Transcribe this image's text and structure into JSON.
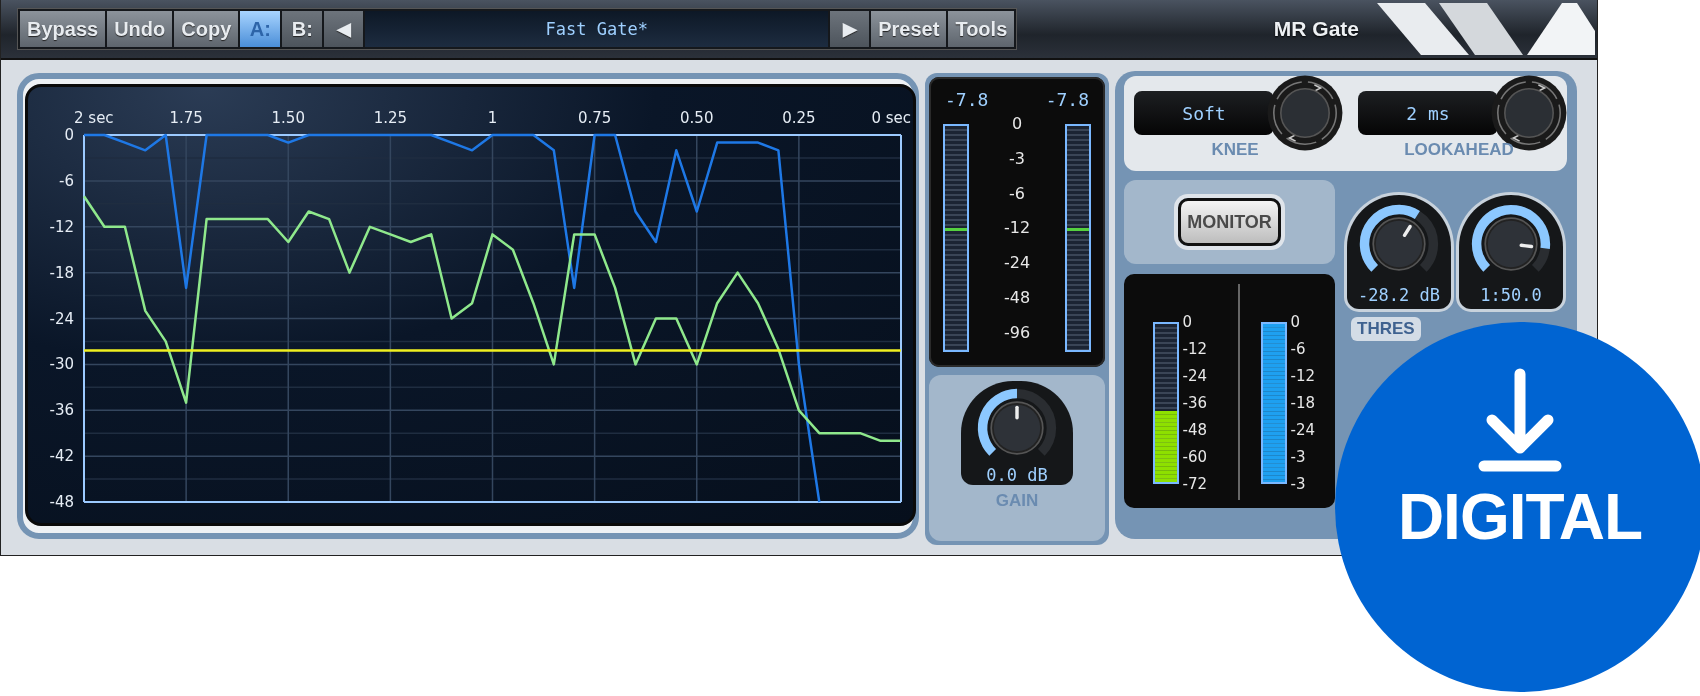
{
  "toolbar": {
    "buttons": [
      {
        "label": "Bypass"
      },
      {
        "label": "Undo"
      },
      {
        "label": "Copy"
      }
    ],
    "ab": [
      {
        "label": "A:",
        "selected": true
      },
      {
        "label": "B:",
        "selected": false
      }
    ],
    "prev": "◀",
    "preset_name": "Fast Gate*",
    "next": "▶",
    "menus": [
      "Preset",
      "Tools"
    ],
    "title": "MR Gate"
  },
  "graph": {
    "chart_data": {
      "type": "line",
      "x": [
        2,
        1.95,
        1.9,
        1.85,
        1.8,
        1.75,
        1.7,
        1.65,
        1.6,
        1.55,
        1.5,
        1.45,
        1.4,
        1.35,
        1.3,
        1.25,
        1.2,
        1.15,
        1.1,
        1.05,
        1,
        0.95,
        0.9,
        0.85,
        0.8,
        0.75,
        0.7,
        0.65,
        0.6,
        0.55,
        0.5,
        0.45,
        0.4,
        0.35,
        0.3,
        0.25,
        0.2,
        0.15,
        0.1,
        0.05,
        0
      ],
      "series": [
        {
          "color": "#1e78e6",
          "values": [
            0,
            0,
            -1,
            -2,
            0,
            -20,
            0,
            0,
            0,
            0,
            -1,
            0,
            0,
            0,
            0,
            0,
            0,
            0,
            -1,
            -2,
            0,
            0,
            0,
            -2,
            -20,
            0,
            0,
            -10,
            -14,
            -2,
            -10,
            -1,
            -1,
            -1,
            -2,
            -30,
            -48,
            null,
            null,
            null,
            null
          ]
        },
        {
          "color": "#8fe88c",
          "values": [
            -8,
            -12,
            -12,
            -23,
            -27,
            -35,
            -11,
            -11,
            -11,
            -11,
            -14,
            -10,
            -11,
            -18,
            -12,
            -13,
            -14,
            -13,
            -24,
            -22,
            -13,
            -15,
            -22,
            -30,
            -13,
            -13,
            -20,
            -30,
            -24,
            -24,
            -30,
            -22,
            -18,
            -22,
            -28,
            -36,
            -39,
            -39,
            -39,
            -40,
            -40
          ]
        },
        {
          "color": "#f0f020",
          "values": [
            -28.2,
            -28.2,
            -28.2,
            -28.2,
            -28.2,
            -28.2,
            -28.2,
            -28.2,
            -28.2,
            -28.2,
            -28.2,
            -28.2,
            -28.2,
            -28.2,
            -28.2,
            -28.2,
            -28.2,
            -28.2,
            -28.2,
            -28.2,
            -28.2,
            -28.2,
            -28.2,
            -28.2,
            -28.2,
            -28.2,
            -28.2,
            -28.2,
            -28.2,
            -28.2,
            -28.2,
            -28.2,
            -28.2,
            -28.2,
            -28.2,
            -28.2,
            -28.2,
            -28.2,
            -28.2,
            -28.2,
            -28.2
          ]
        }
      ],
      "xlim": [
        2,
        0
      ],
      "ylim": [
        -48,
        0
      ],
      "xticks": [
        {
          "value": 2,
          "label": "2 sec"
        },
        {
          "value": 1.75,
          "label": "1.75"
        },
        {
          "value": 1.5,
          "label": "1.50"
        },
        {
          "value": 1.25,
          "label": "1.25"
        },
        {
          "value": 1,
          "label": "1"
        },
        {
          "value": 0.75,
          "label": "0.75"
        },
        {
          "value": 0.5,
          "label": "0.50"
        },
        {
          "value": 0.25,
          "label": "0.25"
        },
        {
          "value": 0,
          "label": "0 sec"
        }
      ],
      "yticks": [
        0,
        -6,
        -12,
        -18,
        -24,
        -30,
        -36,
        -42,
        -48
      ],
      "grid": true
    }
  },
  "input_meters": {
    "channels": [
      {
        "reading": "-7.8",
        "level": 0.53
      },
      {
        "reading": "-7.8",
        "level": 0.53
      }
    ],
    "scale": [
      "0",
      "-3",
      "-6",
      "-12",
      "-24",
      "-48",
      "-96"
    ]
  },
  "gain": {
    "value": "0.0 dB",
    "label": "GAIN"
  },
  "knee": {
    "value": "Soft",
    "label": "KNEE"
  },
  "lookahead": {
    "value": "2 ms",
    "label": "LOOKAHEAD"
  },
  "monitor": {
    "label": "MONITOR"
  },
  "output_meters": [
    {
      "color": "#8ee000",
      "level": 0.45,
      "scale": [
        "0",
        "-12",
        "-24",
        "-36",
        "-48",
        "-60",
        "-72"
      ]
    },
    {
      "color": "#1ea0f0",
      "level": 1,
      "scale": [
        "0",
        "-6",
        "-12",
        "-18",
        "-24",
        "-3",
        "-3"
      ]
    }
  ],
  "threshold": {
    "value": "-28.2 dB",
    "label": "THRES"
  },
  "ratio": {
    "value": "1:50.0"
  },
  "badge": {
    "label": "DIGITAL"
  }
}
